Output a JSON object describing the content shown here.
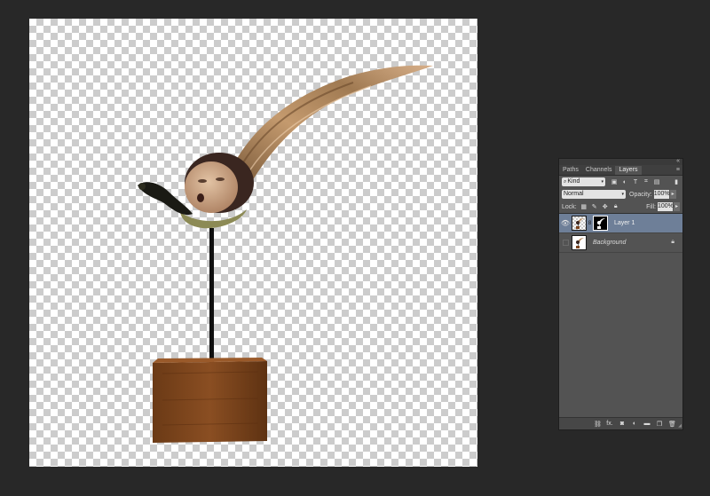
{
  "panel": {
    "tabs": [
      {
        "label": "Paths"
      },
      {
        "label": "Channels"
      },
      {
        "label": "Layers"
      }
    ],
    "active_tab": "Layers",
    "filter": {
      "label": "Kind",
      "icons": [
        "image-filter-icon",
        "adjustment-filter-icon",
        "type-filter-icon",
        "shape-filter-icon",
        "smart-object-filter-icon"
      ]
    },
    "blend_mode": "Normal",
    "opacity_label": "Opacity:",
    "opacity_value": "100%",
    "lock_label": "Lock:",
    "fill_label": "Fill:",
    "fill_value": "100%",
    "layers": [
      {
        "name": "Layer 1",
        "visible": true,
        "selected": true,
        "has_mask": true
      },
      {
        "name": "Background",
        "visible": false,
        "selected": false,
        "locked": true
      }
    ],
    "bottom_icons": [
      "link-layers-icon",
      "fx-icon",
      "add-mask-icon",
      "adjustment-layer-icon",
      "new-group-icon",
      "new-layer-icon",
      "delete-layer-icon"
    ],
    "fx_label": "fx."
  },
  "colors": {
    "app_background": "#282828",
    "panel_background": "#535353",
    "selected_layer": "#6e7f98"
  }
}
